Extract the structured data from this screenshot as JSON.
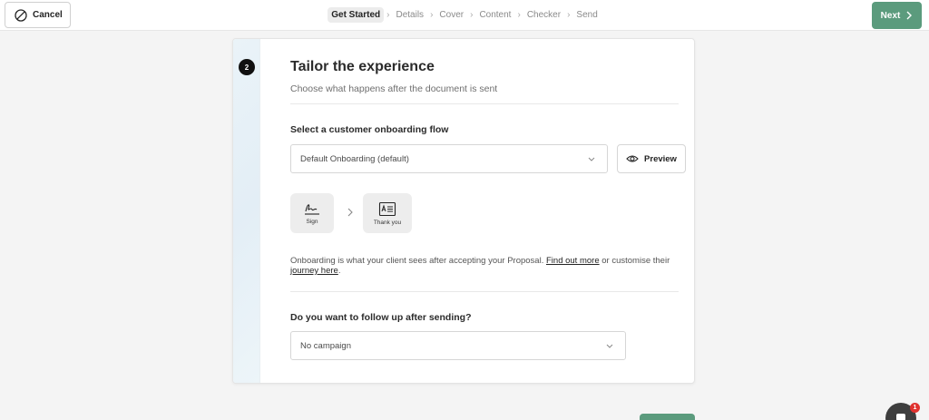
{
  "topbar": {
    "cancel_label": "Cancel",
    "next_label": "Next",
    "steps": [
      "Get Started",
      "Details",
      "Cover",
      "Content",
      "Checker",
      "Send"
    ],
    "active_step": 0
  },
  "card": {
    "step_number": "2",
    "title": "Tailor the experience",
    "subtitle": "Choose what happens after the document is sent",
    "onboarding": {
      "label": "Select a customer onboarding flow",
      "selected": "Default Onboarding (default)",
      "preview_label": "Preview",
      "flow_steps": [
        {
          "label": "Sign",
          "icon": "signature-icon"
        },
        {
          "label": "Thank you",
          "icon": "thank-you-card-icon"
        }
      ]
    },
    "info": {
      "text_before": "Onboarding is what your client sees after accepting your Proposal. ",
      "link1": "Find out more",
      "text_middle": " or customise their ",
      "link2": "journey here",
      "text_after": "."
    },
    "followup": {
      "label": "Do you want to follow up after sending?",
      "selected": "No campaign"
    }
  },
  "chat": {
    "badge_count": "1"
  },
  "colors": {
    "accent": "#5b9b7d",
    "badge": "#e0322f"
  }
}
